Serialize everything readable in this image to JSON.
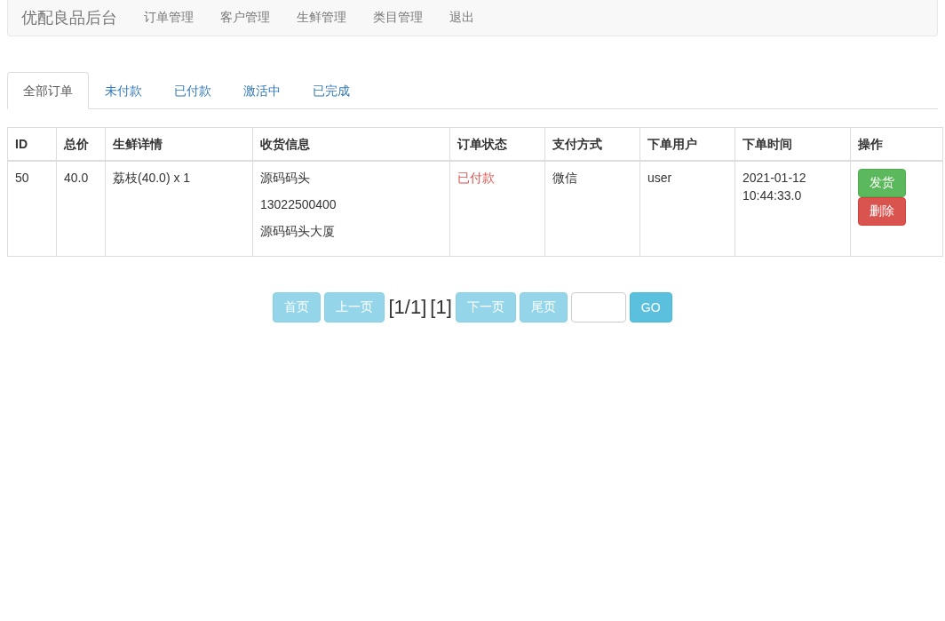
{
  "navbar": {
    "brand": "优配良品后台",
    "links": [
      "订单管理",
      "客户管理",
      "生鲜管理",
      "类目管理",
      "退出"
    ]
  },
  "tabs": [
    {
      "label": "全部订单",
      "selected": true
    },
    {
      "label": "未付款",
      "selected": false
    },
    {
      "label": "已付款",
      "selected": false
    },
    {
      "label": "激活中",
      "selected": false
    },
    {
      "label": "已完成",
      "selected": false
    }
  ],
  "table": {
    "columns": [
      "ID",
      "总价",
      "生鲜详情",
      "收货信息",
      "订单状态",
      "支付方式",
      "下单用户",
      "下单时间",
      "操作"
    ],
    "rows": [
      {
        "id": "50",
        "total": "40.0",
        "detail": "荔枝(40.0) x 1",
        "shipping": [
          "源码码头",
          "13022500400",
          "源码码头大厦"
        ],
        "status": "已付款",
        "color": "#d9534f",
        "payment": "微信",
        "user": "user",
        "time": [
          "2021-01-12",
          "10:44:33.0"
        ],
        "actions": [
          {
            "label": "发货",
            "kind": "success"
          },
          {
            "label": "删除",
            "kind": "danger"
          }
        ]
      }
    ]
  },
  "pagination": {
    "first": {
      "label": "首页",
      "disabled": true
    },
    "prev": {
      "label": "上一页",
      "disabled": true
    },
    "page_info": "[1/1]",
    "current": "[1]",
    "next": {
      "label": "下一页",
      "disabled": true
    },
    "last": {
      "label": "尾页",
      "disabled": true
    },
    "go": {
      "label": "GO",
      "disabled": false
    }
  }
}
